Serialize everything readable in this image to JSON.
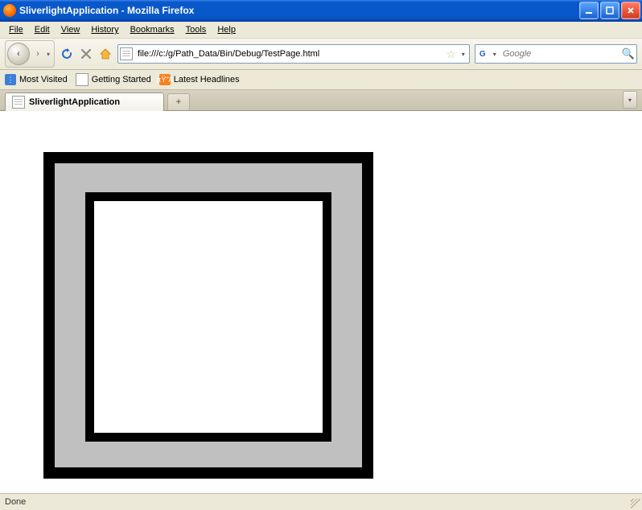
{
  "window": {
    "title": "SliverlightApplication - Mozilla Firefox"
  },
  "menus": {
    "file": "File",
    "edit": "Edit",
    "view": "View",
    "history": "History",
    "bookmarks": "Bookmarks",
    "tools": "Tools",
    "help": "Help"
  },
  "url": {
    "value": "file:///c:/g/Path_Data/Bin/Debug/TestPage.html"
  },
  "search": {
    "placeholder": "Google"
  },
  "bookmarks": {
    "most_visited": "Most Visited",
    "getting_started": "Getting Started",
    "latest_headlines": "Latest Headlines"
  },
  "tabs": {
    "active": "SliverlightApplication",
    "new_tab_glyph": "+"
  },
  "status": {
    "text": "Done"
  },
  "glyphs": {
    "back": "‹",
    "forward": "›",
    "drop": "▾",
    "star": "☆",
    "mag": "🔍",
    "plus": "+"
  },
  "colors": {
    "titlebar": "#0858c9",
    "chrome": "#ece9d8"
  },
  "silverlight": {
    "outer_stroke": "#000000",
    "inner_stroke": "#000000",
    "fill_between": "#c0c0c0",
    "inner_fill": "#ffffff"
  }
}
